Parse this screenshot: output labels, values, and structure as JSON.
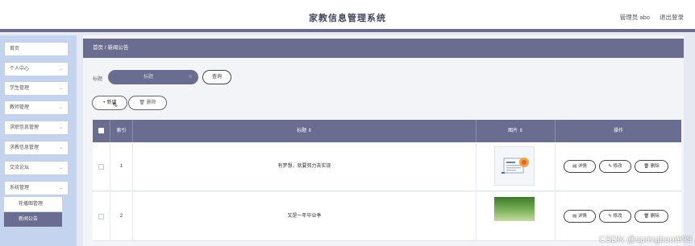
{
  "header": {
    "title": "家教信息管理系统",
    "user_label": "管理员 abo",
    "logout_label": "退出登录"
  },
  "sidebar": {
    "items": [
      {
        "label": "首页",
        "chevron": ""
      },
      {
        "label": "个人中心",
        "chevron": "⌄"
      },
      {
        "label": "学生管理",
        "chevron": "⌄"
      },
      {
        "label": "教师管理",
        "chevron": "⌄"
      },
      {
        "label": "求职信息管理",
        "chevron": "⌄"
      },
      {
        "label": "求教信息管理",
        "chevron": "⌄"
      },
      {
        "label": "交流论坛",
        "chevron": "⌄"
      },
      {
        "label": "系统管理",
        "chevron": "⌄"
      }
    ],
    "sub_items": [
      {
        "label": "轮播图管理",
        "active": false
      },
      {
        "label": "新闻公告",
        "active": true
      }
    ]
  },
  "breadcrumb": "首页 / 新闻公告",
  "search": {
    "label": "标题",
    "placeholder": "标题",
    "icon": "search-icon",
    "query_label": "查询"
  },
  "toolbar": {
    "add_label": "+ 新增",
    "delete_label": "🗑 删除"
  },
  "table": {
    "columns": {
      "index": "索引",
      "title": "标题 ⇕",
      "image": "图片 ⇕",
      "actions": "操作"
    },
    "rows": [
      {
        "index": "1",
        "title": "有梦想，就要努力去实现"
      },
      {
        "index": "2",
        "title": "又是一年毕业季"
      }
    ],
    "action_labels": {
      "detail": "▤ 详情",
      "edit": "✎ 修改",
      "delete": "🗑 删除"
    }
  },
  "watermark": "CSDN @springboot999",
  "colors": {
    "accent": "#6a6d8f",
    "sidebar_bg": "#c5d4ee",
    "page_bg": "#e6e9f2"
  }
}
